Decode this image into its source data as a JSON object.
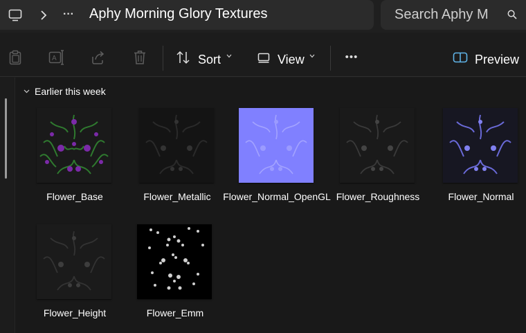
{
  "addressbar": {
    "monitor_icon": "monitor-icon",
    "chevron_icon": "chevron-right-icon",
    "more_icon": "ellipsis-icon",
    "more_label": "···",
    "title": "Aphy Morning Glory Textures",
    "search_text": "Search Aphy M",
    "search_icon": "search-icon"
  },
  "commandbar": {
    "icons": [
      "clipboard-icon",
      "rename-icon",
      "share-icon",
      "trash-icon"
    ],
    "sort_label": "Sort",
    "view_label": "View",
    "more_label": "•••",
    "preview_label": "Preview"
  },
  "content": {
    "group_header": "Earlier this week",
    "files": [
      {
        "name": "Flower_Base",
        "texture": "base"
      },
      {
        "name": "Flower_Metallic",
        "texture": "metallic"
      },
      {
        "name": "Flower_Normal_OpenGL",
        "texture": "normal-opengl"
      },
      {
        "name": "Flower_Roughness",
        "texture": "roughness"
      },
      {
        "name": "Flower_Normal",
        "texture": "normal"
      },
      {
        "name": "Flower_Height",
        "texture": "height"
      },
      {
        "name": "Flower_Emm",
        "texture": "emission"
      }
    ]
  },
  "colors": {
    "background": "#191919",
    "bar": "#2b2b2b",
    "normal_map": "#8080ff"
  }
}
